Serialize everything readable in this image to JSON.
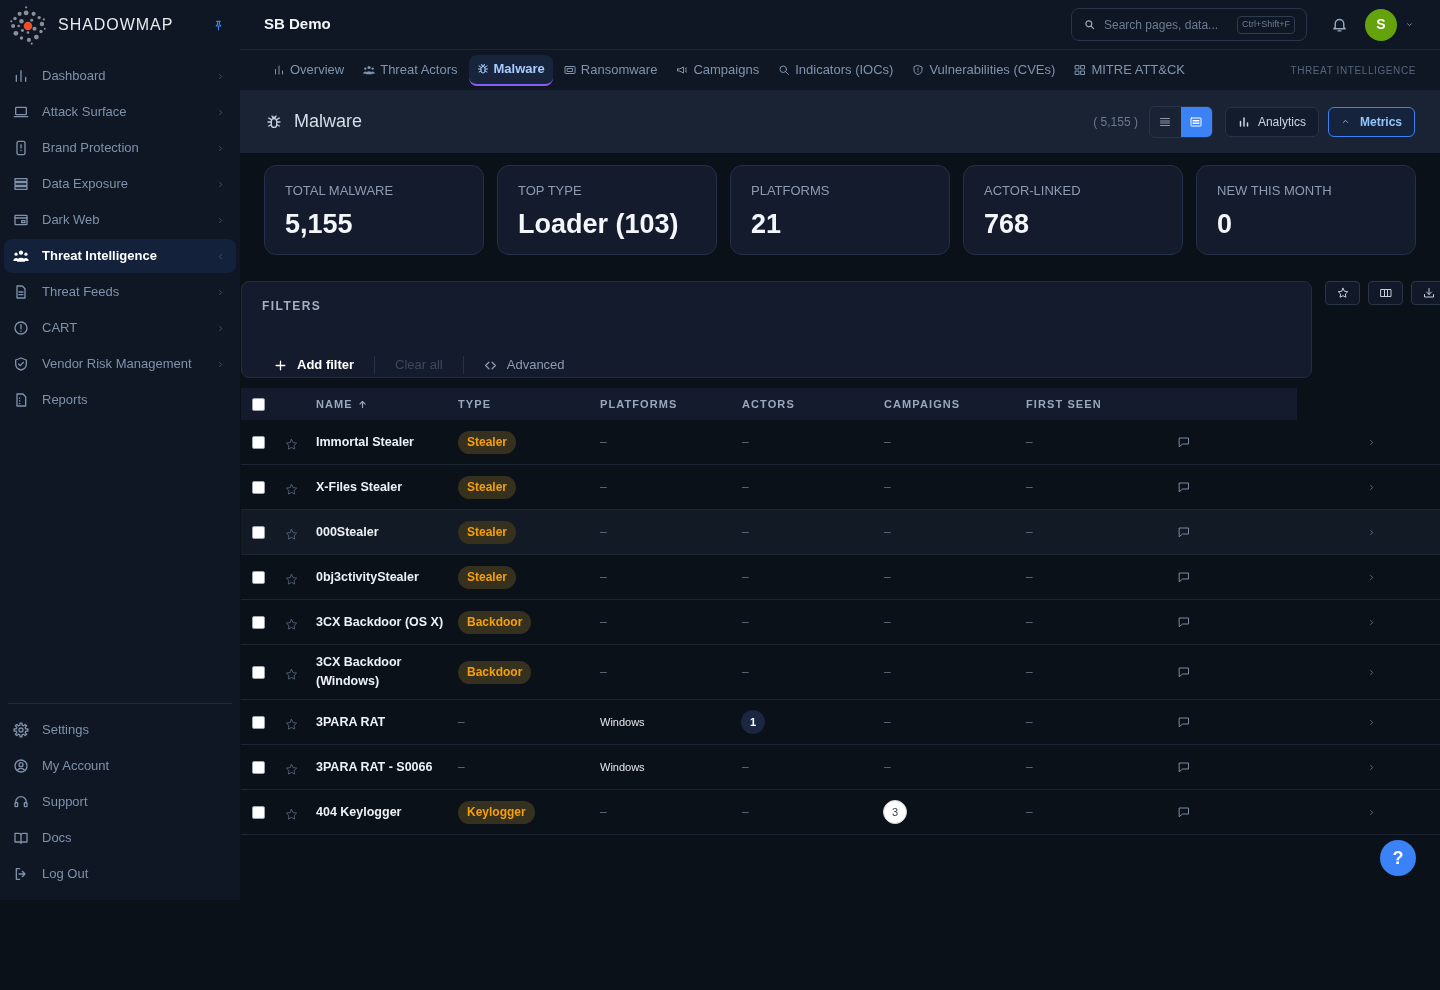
{
  "brand": {
    "name": "SHADOWMAP",
    "pinned": true
  },
  "sidebar": {
    "items": [
      {
        "label": "Dashboard",
        "kind": "group",
        "selected": false
      },
      {
        "label": "Attack Surface",
        "kind": "group",
        "selected": false
      },
      {
        "label": "Brand Protection",
        "kind": "group",
        "selected": false
      },
      {
        "label": "Data Exposure",
        "kind": "group",
        "selected": false
      },
      {
        "label": "Dark Web",
        "kind": "group",
        "selected": false
      },
      {
        "label": "Threat Intelligence",
        "kind": "group",
        "selected": true
      },
      {
        "label": "Threat Feeds",
        "kind": "group",
        "selected": false
      },
      {
        "label": "CART",
        "kind": "group",
        "selected": false
      },
      {
        "label": "Vendor Risk Management",
        "kind": "group",
        "selected": false
      },
      {
        "label": "Reports",
        "kind": "link",
        "selected": false
      }
    ],
    "footer_items": [
      {
        "label": "Settings"
      },
      {
        "label": "My Account"
      },
      {
        "label": "Support"
      },
      {
        "label": "Docs"
      },
      {
        "label": "Log Out"
      }
    ]
  },
  "topbar": {
    "workspace": "SB Demo",
    "search": {
      "placeholder": "Search pages, data...",
      "shortcut": "Ctrl+Shift+F"
    },
    "avatar": {
      "initial": "S"
    }
  },
  "tabs": [
    {
      "label": "Overview",
      "selected": false
    },
    {
      "label": "Threat Actors",
      "selected": false
    },
    {
      "label": "Malware",
      "selected": true
    },
    {
      "label": "Ransomware",
      "selected": false
    },
    {
      "label": "Campaigns",
      "selected": false
    },
    {
      "label": "Indicators (IOCs)",
      "selected": false
    },
    {
      "label": "Vulnerabilities (CVEs)",
      "selected": false
    },
    {
      "label": "MITRE ATT&CK",
      "selected": false
    }
  ],
  "section_label": "THREAT INTELLIGENCE",
  "page_header": {
    "title": "Malware",
    "count": "( 5,155 )",
    "views": [
      {
        "kind": "list",
        "selected": false
      },
      {
        "kind": "cards",
        "selected": true
      }
    ],
    "buttons": [
      {
        "kind": "analytics",
        "label": "Analytics",
        "selected": false
      },
      {
        "kind": "metrics",
        "label": "Metrics",
        "selected": true
      }
    ]
  },
  "metrics": [
    {
      "label": "TOTAL MALWARE",
      "value": "5,155"
    },
    {
      "label": "TOP TYPE",
      "value": "Loader (103)"
    },
    {
      "label": "PLATFORMS",
      "value": "21"
    },
    {
      "label": "ACTOR-LINKED",
      "value": "768"
    },
    {
      "label": "NEW THIS MONTH",
      "value": "0"
    }
  ],
  "filters": {
    "title": "FILTERS",
    "actions": [
      {
        "kind": "add",
        "label": "Add filter",
        "disabled": false
      },
      {
        "kind": "clear",
        "label": "Clear all",
        "disabled": true
      },
      {
        "kind": "advanced",
        "label": "Advanced",
        "disabled": false
      }
    ]
  },
  "table": {
    "select_all": {
      "checked": false
    },
    "columns": [
      {
        "label": "NAME",
        "sorted": true
      },
      {
        "label": "TYPE",
        "sorted": false
      },
      {
        "label": "PLATFORMS",
        "sorted": false
      },
      {
        "label": "ACTORS",
        "sorted": false
      },
      {
        "label": "CAMPAIGNS",
        "sorted": false
      },
      {
        "label": "FIRST SEEN",
        "sorted": false
      }
    ],
    "rows": [
      {
        "checked": false,
        "starred": false,
        "highlighted": false,
        "name": "Immortal Stealer",
        "type": {
          "kind": "badge",
          "text": "Stealer"
        },
        "platforms": {
          "kind": "empty",
          "text": "–"
        },
        "actors": {
          "kind": "empty",
          "text": "–"
        },
        "campaigns": {
          "kind": "empty",
          "text": "–"
        },
        "first_seen": {
          "kind": "empty",
          "text": "–"
        }
      },
      {
        "checked": false,
        "starred": false,
        "highlighted": false,
        "name": "X-Files Stealer",
        "type": {
          "kind": "badge",
          "text": "Stealer"
        },
        "platforms": {
          "kind": "empty",
          "text": "–"
        },
        "actors": {
          "kind": "empty",
          "text": "–"
        },
        "campaigns": {
          "kind": "empty",
          "text": "–"
        },
        "first_seen": {
          "kind": "empty",
          "text": "–"
        }
      },
      {
        "checked": false,
        "starred": false,
        "highlighted": true,
        "name": "000Stealer",
        "type": {
          "kind": "badge",
          "text": "Stealer"
        },
        "platforms": {
          "kind": "empty",
          "text": "–"
        },
        "actors": {
          "kind": "empty",
          "text": "–"
        },
        "campaigns": {
          "kind": "empty",
          "text": "–"
        },
        "first_seen": {
          "kind": "empty",
          "text": "–"
        }
      },
      {
        "checked": false,
        "starred": false,
        "highlighted": false,
        "name": "0bj3ctivityStealer",
        "type": {
          "kind": "badge",
          "text": "Stealer"
        },
        "platforms": {
          "kind": "empty",
          "text": "–"
        },
        "actors": {
          "kind": "empty",
          "text": "–"
        },
        "campaigns": {
          "kind": "empty",
          "text": "–"
        },
        "first_seen": {
          "kind": "empty",
          "text": "–"
        }
      },
      {
        "checked": false,
        "starred": false,
        "highlighted": false,
        "name": "3CX Backdoor (OS X)",
        "type": {
          "kind": "badge",
          "text": "Backdoor"
        },
        "platforms": {
          "kind": "empty",
          "text": "–"
        },
        "actors": {
          "kind": "empty",
          "text": "–"
        },
        "campaigns": {
          "kind": "empty",
          "text": "–"
        },
        "first_seen": {
          "kind": "empty",
          "text": "–"
        }
      },
      {
        "checked": false,
        "starred": false,
        "highlighted": false,
        "name": "3CX Backdoor (Windows)",
        "type": {
          "kind": "badge",
          "text": "Backdoor"
        },
        "platforms": {
          "kind": "empty",
          "text": "–"
        },
        "actors": {
          "kind": "empty",
          "text": "–"
        },
        "campaigns": {
          "kind": "empty",
          "text": "–"
        },
        "first_seen": {
          "kind": "empty",
          "text": "–"
        }
      },
      {
        "checked": false,
        "starred": false,
        "highlighted": false,
        "name": "3PARA RAT",
        "type": {
          "kind": "empty",
          "text": "–"
        },
        "platforms": {
          "kind": "text",
          "text": "Windows"
        },
        "actors": {
          "kind": "count",
          "text": "1"
        },
        "campaigns": {
          "kind": "empty",
          "text": "–"
        },
        "first_seen": {
          "kind": "empty",
          "text": "–"
        }
      },
      {
        "checked": false,
        "starred": false,
        "highlighted": false,
        "name": "3PARA RAT - S0066",
        "type": {
          "kind": "empty",
          "text": "–"
        },
        "platforms": {
          "kind": "text",
          "text": "Windows"
        },
        "actors": {
          "kind": "empty",
          "text": "–"
        },
        "campaigns": {
          "kind": "empty",
          "text": "–"
        },
        "first_seen": {
          "kind": "empty",
          "text": "–"
        }
      },
      {
        "checked": false,
        "starred": false,
        "highlighted": false,
        "name": "404 Keylogger",
        "type": {
          "kind": "badge",
          "text": "Keylogger"
        },
        "platforms": {
          "kind": "empty",
          "text": "–"
        },
        "actors": {
          "kind": "empty",
          "text": "–"
        },
        "campaigns": {
          "kind": "count",
          "text": "3"
        },
        "first_seen": {
          "kind": "empty",
          "text": "–"
        }
      }
    ]
  },
  "help": {
    "label": "?"
  }
}
